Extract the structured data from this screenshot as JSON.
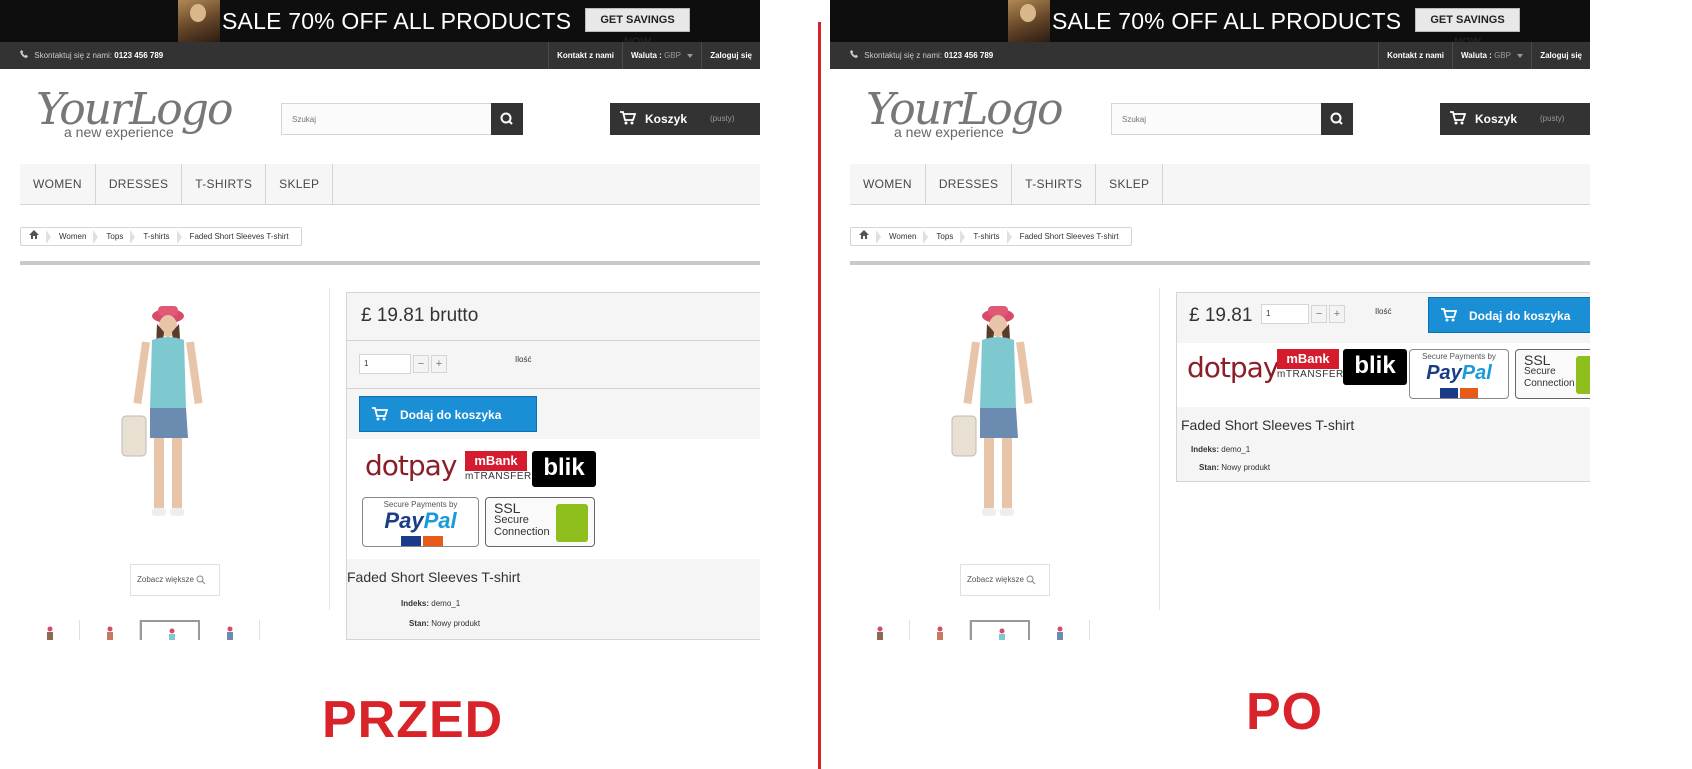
{
  "banner": {
    "text": "SALE 70% OFF ALL PRODUCTS",
    "button": "GET SAVINGS NOW"
  },
  "topnav": {
    "phone_text": "Skontaktuj się z nami:",
    "phone_number": "0123 456 789",
    "contact": "Kontakt z nami",
    "currency_label": "Waluta :",
    "currency_value": "GBP",
    "login": "Zaloguj się"
  },
  "logo": {
    "main": "YourLogo",
    "sub": "a new experience"
  },
  "search": {
    "placeholder": "Szukaj"
  },
  "cart": {
    "label": "Koszyk",
    "status": "(pusty)"
  },
  "menu": [
    "WOMEN",
    "DRESSES",
    "T-SHIRTS",
    "SKLEP"
  ],
  "breadcrumb": [
    "Women",
    "Tops",
    "T-shirts",
    "Faded Short Sleeves T-shirt"
  ],
  "zoom_label": "Zobacz większe",
  "before": {
    "price": "£ 19.81 brutto",
    "qty_value": "1",
    "qty_label": "Ilość",
    "add_to_cart": "Dodaj do koszyka"
  },
  "after": {
    "price": "£ 19.81",
    "qty_value": "1",
    "qty_label": "Ilość",
    "add_to_cart": "Dodaj do koszyka"
  },
  "payments": {
    "dotpay": "dotpay",
    "mbank_top": "mBank",
    "mbank_bottom": "mTRANSFER",
    "blik": "blik",
    "paypal_secure": "Secure Payments by",
    "paypal_pay": "Pay",
    "paypal_pal": "Pal",
    "ssl_line1": "SSL",
    "ssl_line2": "Secure",
    "ssl_line3": "Connection"
  },
  "product": {
    "name": "Faded Short Sleeves T-shirt",
    "reference_label": "Indeks:",
    "reference_value": "demo_1",
    "condition_label": "Stan:",
    "condition_value": "Nowy produkt"
  },
  "labels": {
    "before": "PRZED",
    "after": "PO"
  },
  "colors": {
    "accent": "#d8232a",
    "button_blue": "#1a8fd6",
    "dark": "#333333"
  },
  "icons": [
    "phone-icon",
    "search-icon",
    "cart-icon",
    "home-icon",
    "zoom-icon",
    "caret-down-icon"
  ]
}
